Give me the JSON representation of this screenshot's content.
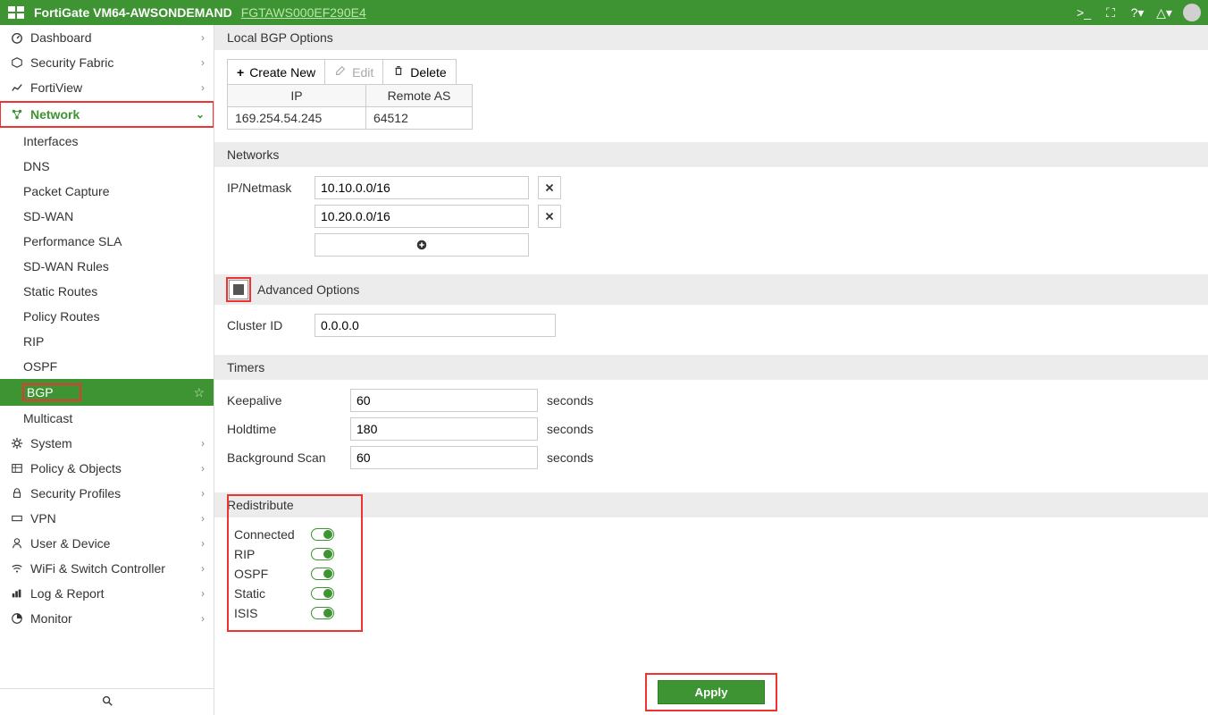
{
  "header": {
    "title": "FortiGate VM64-AWSONDEMAND",
    "serial": "FGTAWS000EF290E4"
  },
  "nav": {
    "dashboard": "Dashboard",
    "security_fabric": "Security Fabric",
    "fortiview": "FortiView",
    "network": "Network",
    "network_items": {
      "interfaces": "Interfaces",
      "dns": "DNS",
      "packet_capture": "Packet Capture",
      "sdwan": "SD-WAN",
      "perf_sla": "Performance SLA",
      "sdwan_rules": "SD-WAN Rules",
      "static_routes": "Static Routes",
      "policy_routes": "Policy Routes",
      "rip": "RIP",
      "ospf": "OSPF",
      "bgp": "BGP",
      "multicast": "Multicast"
    },
    "system": "System",
    "policy_objects": "Policy & Objects",
    "security_profiles": "Security Profiles",
    "vpn": "VPN",
    "user_device": "User & Device",
    "wifi_switch": "WiFi & Switch Controller",
    "log_report": "Log & Report",
    "monitor": "Monitor"
  },
  "local_bgp": {
    "section": "Local BGP Options",
    "create": "Create New",
    "edit": "Edit",
    "delete": "Delete",
    "col_ip": "IP",
    "col_as": "Remote AS",
    "rows": [
      {
        "ip": "169.254.54.245",
        "as": "64512"
      }
    ]
  },
  "networks": {
    "section": "Networks",
    "label": "IP/Netmask",
    "values": [
      "10.10.0.0/16",
      "10.20.0.0/16"
    ]
  },
  "advanced": {
    "section": "Advanced Options",
    "cluster_label": "Cluster ID",
    "cluster_value": "0.0.0.0"
  },
  "timers": {
    "section": "Timers",
    "keepalive_label": "Keepalive",
    "keepalive_value": "60",
    "holdtime_label": "Holdtime",
    "holdtime_value": "180",
    "bg_label": "Background Scan",
    "bg_value": "60",
    "unit": "seconds"
  },
  "redistribute": {
    "section": "Redistribute",
    "items": [
      {
        "label": "Connected"
      },
      {
        "label": "RIP"
      },
      {
        "label": "OSPF"
      },
      {
        "label": "Static"
      },
      {
        "label": "ISIS"
      }
    ]
  },
  "apply": "Apply"
}
